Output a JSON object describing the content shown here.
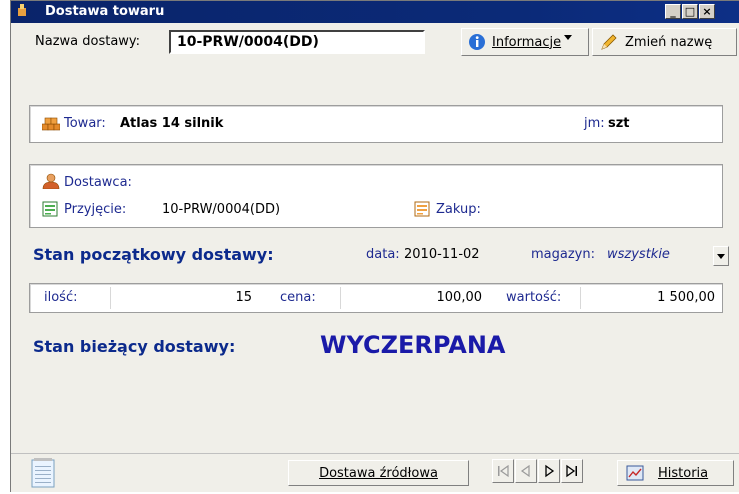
{
  "window": {
    "title": "Dostawa towaru"
  },
  "name_bar": {
    "label": "Nazwa dostawy:",
    "value": "10-PRW/0004(DD)",
    "info_button": "Informacje",
    "rename_button": "Zmień nazwę"
  },
  "product": {
    "label": "Towar:",
    "name": "Atlas 14 silnik",
    "unit_label": "jm:",
    "unit": "szt"
  },
  "supplier": {
    "supplier_label": "Dostawca:",
    "supplier_value": "",
    "receipt_label": "Przyjęcie:",
    "receipt_value": "10-PRW/0004(DD)",
    "purchase_label": "Zakup:",
    "purchase_value": ""
  },
  "initial_state": {
    "heading": "Stan początkowy dostawy:",
    "date_label": "data:",
    "date_value": "2010-11-02",
    "warehouse_label": "magazyn:",
    "warehouse_value": "wszystkie"
  },
  "values": {
    "qty_label": "ilość:",
    "qty": "15",
    "price_label": "cena:",
    "price": "100,00",
    "value_label": "wartość:",
    "value": "1 500,00"
  },
  "current_state": {
    "heading": "Stan bieżący dostawy:",
    "status": "WYCZERPANA"
  },
  "footer": {
    "source_button": "Dostawa źródłowa",
    "history_button": "Historia"
  },
  "colors": {
    "titlebar": "#0a246a",
    "heading": "#0c2a8c",
    "status": "#1a1aa8"
  }
}
